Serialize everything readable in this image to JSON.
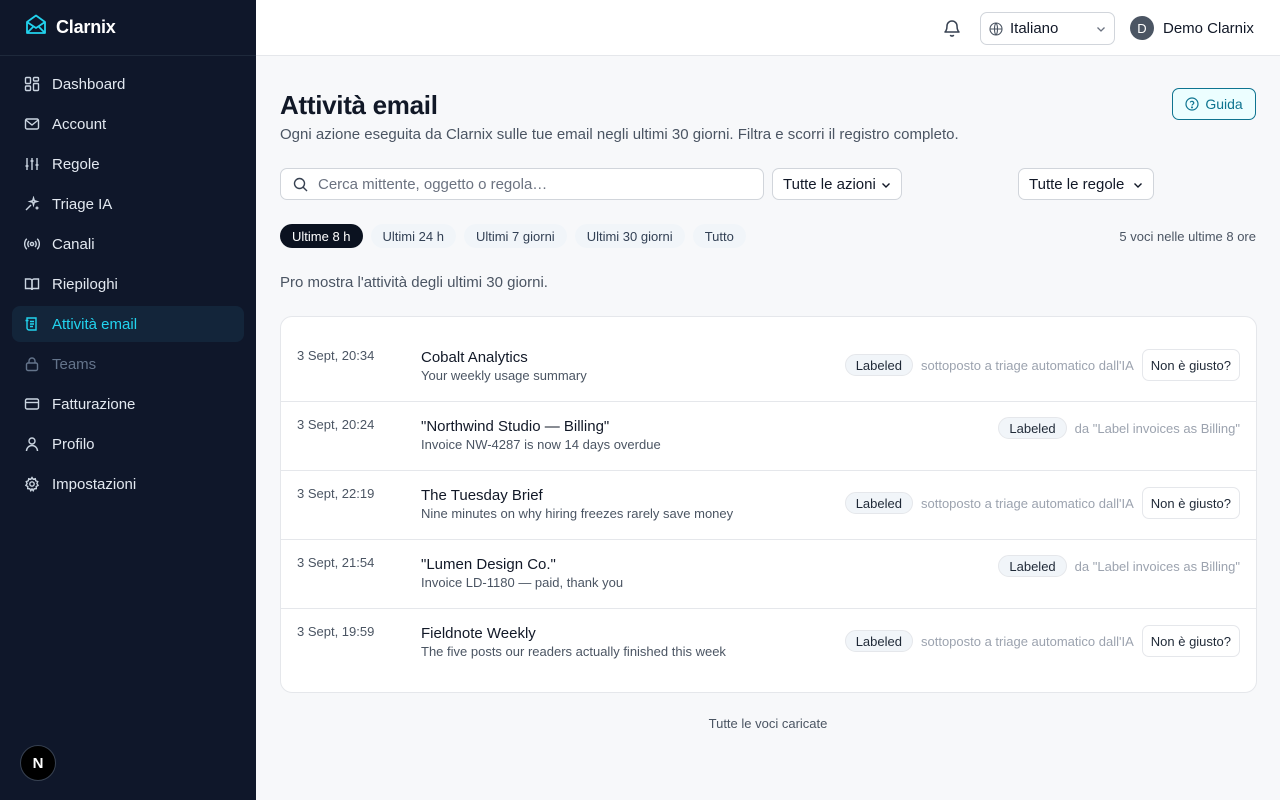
{
  "app": {
    "name": "Clarnix"
  },
  "sidebar": {
    "items": [
      {
        "label": "Dashboard",
        "icon": "dashboard-icon"
      },
      {
        "label": "Account",
        "icon": "mail-icon"
      },
      {
        "label": "Regole",
        "icon": "sliders-icon"
      },
      {
        "label": "Triage IA",
        "icon": "sparkles-icon"
      },
      {
        "label": "Canali",
        "icon": "radio-icon"
      },
      {
        "label": "Riepiloghi",
        "icon": "book-icon"
      },
      {
        "label": "Attività email",
        "icon": "activity-log-icon",
        "active": true
      },
      {
        "label": "Teams",
        "icon": "lock-icon",
        "disabled": true
      },
      {
        "label": "Fatturazione",
        "icon": "credit-card-icon"
      },
      {
        "label": "Profilo",
        "icon": "user-icon"
      },
      {
        "label": "Impostazioni",
        "icon": "gear-icon"
      }
    ],
    "footer_badge": "N"
  },
  "header": {
    "language": "Italiano",
    "user_initial": "D",
    "user_name": "Demo Clarnix"
  },
  "page": {
    "title": "Attività email",
    "subtitle": "Ogni azione eseguita da Clarnix sulle tue email negli ultimi 30 giorni. Filtra e scorri il registro completo.",
    "help_label": "Guida",
    "search_placeholder": "Cerca mittente, oggetto o regola…",
    "filter_actions": "Tutte le azioni",
    "filter_rules": "Tutte le regole",
    "ranges": [
      "Ultime 8 h",
      "Ultimi 24 h",
      "Ultimi 7 giorni",
      "Ultimi 30 giorni",
      "Tutto"
    ],
    "active_range": 0,
    "count_text": "5 voci nelle ultime 8 ore",
    "pro_note": "Pro mostra l'attività degli ultimi 30 giorni.",
    "footer_note": "Tutte le voci caricate"
  },
  "activity": [
    {
      "time": "3 Sept, 20:34",
      "subject": "Cobalt Analytics",
      "snippet": "Your weekly usage summary",
      "badge": "Labeled",
      "reason": "sottoposto a triage automatico dall'IA",
      "action": "Non è giusto?"
    },
    {
      "time": "3 Sept, 20:24",
      "subject": "\"Northwind Studio — Billing\"",
      "snippet": "Invoice NW-4287 is now 14 days overdue",
      "badge": "Labeled",
      "reason": "da \"Label invoices as Billing\"",
      "action": ""
    },
    {
      "time": "3 Sept, 22:19",
      "subject": "The Tuesday Brief",
      "snippet": "Nine minutes on why hiring freezes rarely save money",
      "badge": "Labeled",
      "reason": "sottoposto a triage automatico dall'IA",
      "action": "Non è giusto?"
    },
    {
      "time": "3 Sept, 21:54",
      "subject": "\"Lumen Design Co.\"",
      "snippet": "Invoice LD-1180 — paid, thank you",
      "badge": "Labeled",
      "reason": "da \"Label invoices as Billing\"",
      "action": ""
    },
    {
      "time": "3 Sept, 19:59",
      "subject": "Fieldnote Weekly",
      "snippet": "The five posts our readers actually finished this week",
      "badge": "Labeled",
      "reason": "sottoposto a triage automatico dall'IA",
      "action": "Non è giusto?"
    }
  ],
  "colors": {
    "sidebar_bg": "#0f172a",
    "accent": "#22d3ee",
    "help_accent": "#0e7490"
  }
}
